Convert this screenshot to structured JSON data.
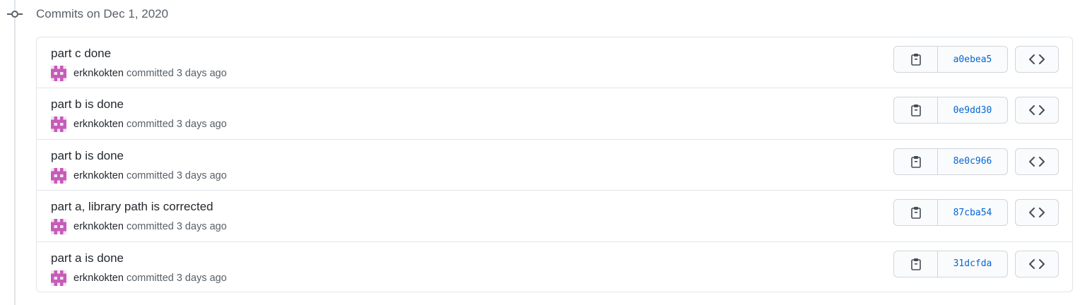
{
  "group": {
    "title": "Commits on Dec 1, 2020"
  },
  "icons": {
    "commit_node": "git-commit-icon",
    "avatar": "identicon-avatar",
    "copy": "clipboard-icon",
    "browse": "code-icon"
  },
  "colors": {
    "avatar": "#c65cb8",
    "sha_link": "#0366d6",
    "border": "#e1e4e8"
  },
  "commits": [
    {
      "title": "part c done",
      "author": "erknkokten",
      "meta": "committed 3 days ago",
      "sha": "a0ebea5"
    },
    {
      "title": "part b is done",
      "author": "erknkokten",
      "meta": "committed 3 days ago",
      "sha": "0e9dd30"
    },
    {
      "title": "part b is done",
      "author": "erknkokten",
      "meta": "committed 3 days ago",
      "sha": "8e0c966"
    },
    {
      "title": "part a, library path is corrected",
      "author": "erknkokten",
      "meta": "committed 3 days ago",
      "sha": "87cba54"
    },
    {
      "title": "part a is done",
      "author": "erknkokten",
      "meta": "committed 3 days ago",
      "sha": "31dcfda"
    }
  ]
}
